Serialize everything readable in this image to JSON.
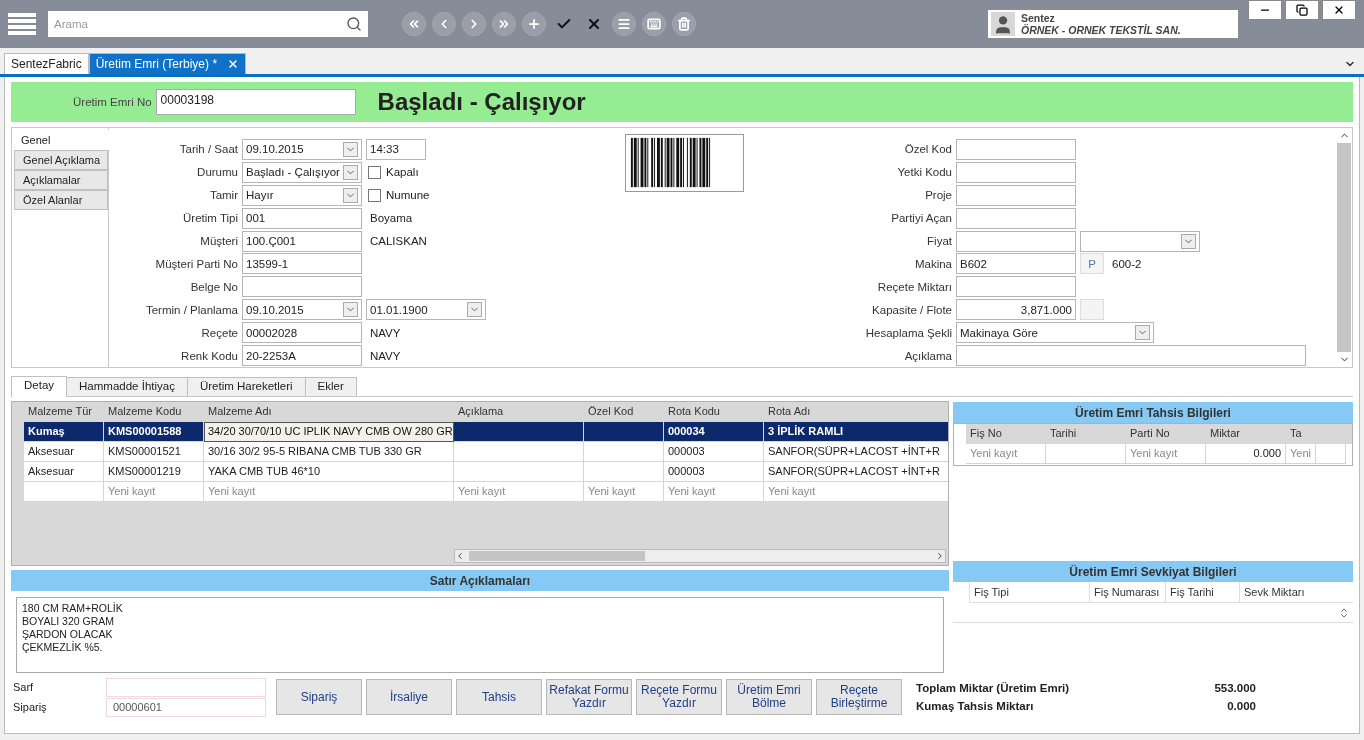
{
  "toolbar": {
    "search": {
      "placeholder": "Arama"
    },
    "buttons": [
      {
        "kind": "first"
      },
      {
        "kind": "previous"
      },
      {
        "kind": "next"
      },
      {
        "kind": "last"
      },
      {
        "kind": "add"
      },
      {
        "kind": "save"
      },
      {
        "kind": "cancel"
      },
      {
        "kind": "list"
      },
      {
        "kind": "keyboard"
      },
      {
        "kind": "delete"
      }
    ]
  },
  "user": {
    "name": "Sentez",
    "company": "ÖRNEK - ORNEK TEKSTİL SAN."
  },
  "window_buttons": [
    {
      "kind": "minimize"
    },
    {
      "kind": "restore"
    },
    {
      "kind": "close"
    }
  ],
  "doc_tabs": [
    {
      "label": "SentezFabric",
      "selected": false,
      "closable": false
    },
    {
      "label": "Üretim Emri (Terbiye) *",
      "selected": true,
      "closable": true
    }
  ],
  "header": {
    "label": "Üretim Emri No",
    "value": "00003198",
    "status": "Başladı - Çalışıyor"
  },
  "side_tabs": [
    {
      "label": "Genel",
      "selected": true
    },
    {
      "label": "Genel Açıklama",
      "selected": false
    },
    {
      "label": "Açıklamalar",
      "selected": false
    },
    {
      "label": "Özel Alanlar",
      "selected": false
    }
  ],
  "form_left": [
    {
      "label": "Tarih / Saat",
      "kind": "combo",
      "value": "09.10.2015",
      "extras": [
        {
          "kind": "text",
          "value": "14:33"
        }
      ]
    },
    {
      "label": "Durumu",
      "kind": "combo",
      "value": "Başladı - Çalışıyor",
      "extras": [
        {
          "kind": "checkbox",
          "label": "Kapalı",
          "checked": false
        }
      ]
    },
    {
      "label": "Tamir",
      "kind": "combo",
      "value": "Hayır",
      "extras": [
        {
          "kind": "checkbox",
          "label": "Numune",
          "checked": false
        }
      ]
    },
    {
      "label": "Üretim Tipi",
      "kind": "text",
      "value": "001",
      "extras": [
        {
          "kind": "note",
          "value": "Boyama"
        }
      ]
    },
    {
      "label": "Müşteri",
      "kind": "text",
      "value": "100.Ç001",
      "extras": [
        {
          "kind": "note",
          "value": "CALISKAN"
        }
      ]
    },
    {
      "label": "Müşteri Parti No",
      "kind": "text",
      "value": "13599-1"
    },
    {
      "label": "Belge No",
      "kind": "text"
    },
    {
      "label": "Termin / Planlama",
      "kind": "combo",
      "value": "09.10.2015",
      "extras": [
        {
          "kind": "combo",
          "value": "01.01.1900"
        }
      ]
    },
    {
      "label": "Reçete",
      "kind": "text",
      "value": "00002028",
      "extras": [
        {
          "kind": "note",
          "value": "NAVY"
        }
      ]
    },
    {
      "label": "Renk Kodu",
      "kind": "text",
      "value": "20-2253A",
      "extras": [
        {
          "kind": "note",
          "value": "NAVY"
        }
      ]
    }
  ],
  "form_right": [
    {
      "label": "Özel Kod",
      "kind": "text"
    },
    {
      "label": "Yetki Kodu",
      "kind": "text"
    },
    {
      "label": "Proje",
      "kind": "text"
    },
    {
      "label": "Partiyi Açan",
      "kind": "text"
    },
    {
      "label": "Fiyat",
      "kind": "text",
      "extras": [
        {
          "kind": "combo"
        }
      ]
    },
    {
      "label": "Makina",
      "kind": "text",
      "value": "B602",
      "extras": [
        {
          "kind": "button",
          "value": "P"
        },
        {
          "kind": "note",
          "value": "600-2"
        }
      ]
    },
    {
      "label": "Reçete Miktarı",
      "kind": "text"
    },
    {
      "label": "Kapasite / Flote",
      "kind": "number",
      "value": "3,871.000",
      "extras": [
        {
          "kind": "button"
        }
      ]
    },
    {
      "label": "Hesaplama Şekli",
      "kind": "wide_combo",
      "value": "Makinaya Göre"
    },
    {
      "label": "Açıklama",
      "kind": "wide_text"
    }
  ],
  "detail_tabs": [
    {
      "label": "Detay",
      "selected": true
    },
    {
      "label": "Hammadde İhtiyaç",
      "selected": false
    },
    {
      "label": "Üretim Hareketleri",
      "selected": false
    },
    {
      "label": "Ekler",
      "selected": false
    }
  ],
  "materials": {
    "columns": [
      "Malzeme Tür",
      "Malzeme Kodu",
      "Malzeme Adı",
      "Açıklama",
      "Özel Kod",
      "Rota Kodu",
      "Rota Adı"
    ],
    "rows": [
      {
        "kind": "data",
        "selected": true,
        "cells": [
          "Kumaş",
          "KMS00001588",
          "34/20 30/70/10 UC IPLIK NAVY CMB OW 280 GR",
          null,
          null,
          "000034",
          "3 İPLİK RAMLI"
        ]
      },
      {
        "kind": "data",
        "selected": false,
        "cells": [
          "Aksesuar",
          "KMS00001521",
          "30/16 30/2 95-5 RIBANA CMB TUB 330 GR",
          null,
          null,
          "000003",
          "SANFOR(SÜPR+LACOST +İNT+R"
        ]
      },
      {
        "kind": "data",
        "selected": false,
        "cells": [
          "Aksesuar",
          "KMS00001219",
          "YAKA CMB TUB 46*10",
          null,
          null,
          "000003",
          "SANFOR(SÜPR+LACOST +İNT+R"
        ]
      },
      {
        "kind": "new",
        "selected": false,
        "cells": [
          null,
          "Yeni kayıt",
          "Yeni kayıt",
          "Yeni kayıt",
          "Yeni kayıt",
          "Yeni kayıt",
          "Yeni kayıt"
        ]
      }
    ]
  },
  "allocation": {
    "title": "Üretim Emri Tahsis Bilgileri",
    "columns": [
      "Fiş No",
      "Tarihi",
      "Parti No",
      "Miktar",
      "Ta"
    ],
    "rows": [
      {
        "kind": "new",
        "cells": [
          "Yeni kayıt",
          null,
          "Yeni kayıt",
          "0.000",
          "Yeni"
        ]
      }
    ]
  },
  "shipment": {
    "title": "Üretim Emri Sevkiyat Bilgileri",
    "columns": [
      "Fiş Tipi",
      "Fiş Numarası",
      "Fiş Tarihi",
      "Sevk Miktarı"
    ]
  },
  "line_notes": {
    "title": "Satır Açıklamaları",
    "lines": [
      "180 CM RAM+ROLİK",
      "BOYALI 320 GRAM",
      "ŞARDON OLACAK",
      "ÇEKMEZLİK %5."
    ]
  },
  "bottom_fields": [
    {
      "label": "Sarf"
    },
    {
      "label": "Sipariş",
      "value": "00000601"
    }
  ],
  "actions": [
    "Sipariş",
    "İrsaliye",
    "Tahsis",
    "Refakat Formu Yazdır",
    "Reçete Formu Yazdır",
    "Üretim Emri Bölme",
    "Reçete Birleştirme"
  ],
  "totals": [
    {
      "label": "Toplam Miktar (Üretim Emri)",
      "value": "553.000"
    },
    {
      "label": "Kumaş Tahsis Miktarı",
      "value": "0.000"
    }
  ]
}
